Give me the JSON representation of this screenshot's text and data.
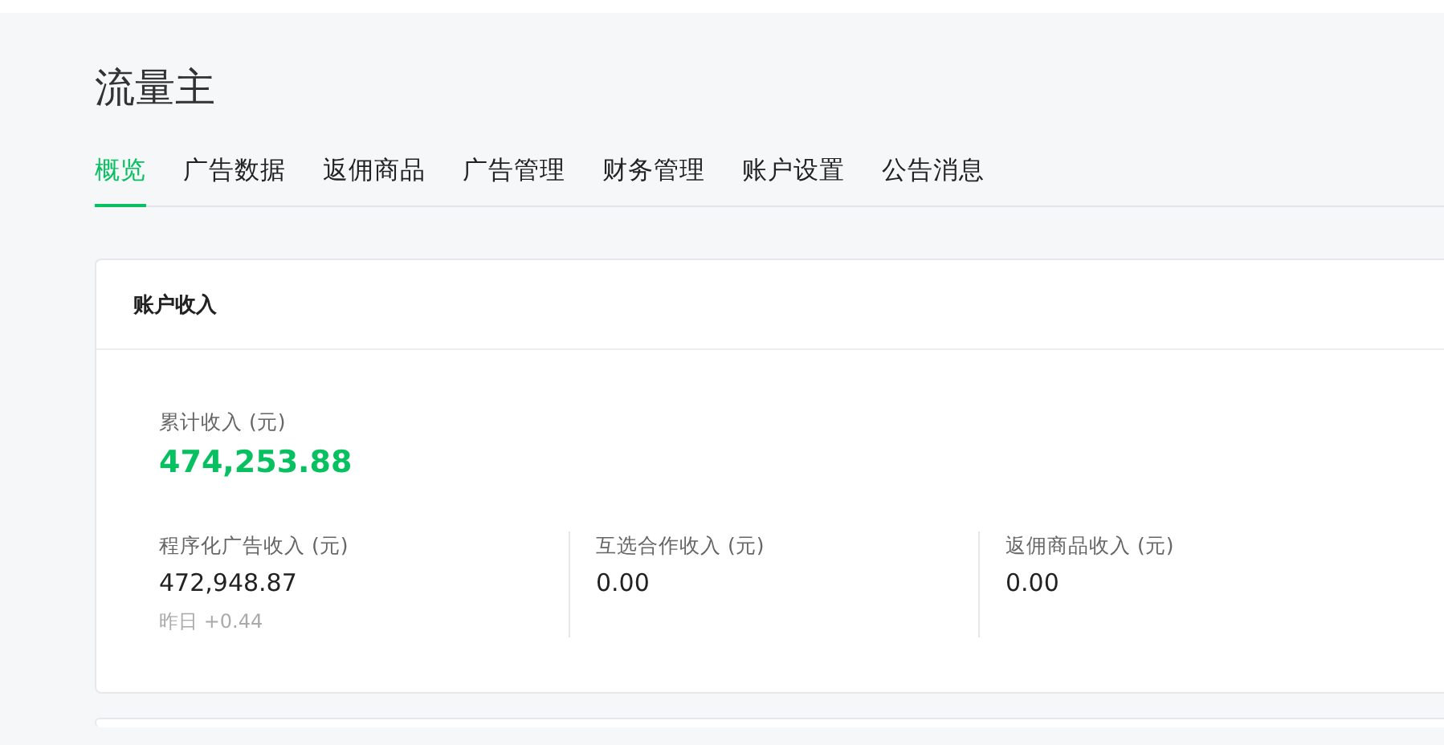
{
  "app": {
    "title": "流量主"
  },
  "tabs": [
    {
      "label": "概览",
      "selected": true
    },
    {
      "label": "广告数据",
      "selected": false
    },
    {
      "label": "返佣商品",
      "selected": false
    },
    {
      "label": "广告管理",
      "selected": false
    },
    {
      "label": "财务管理",
      "selected": false
    },
    {
      "label": "账户设置",
      "selected": false
    },
    {
      "label": "公告消息",
      "selected": false
    }
  ],
  "income_card": {
    "title": "账户收入",
    "total": {
      "label": "累计收入 (元)",
      "value": "474,253.88"
    },
    "items": [
      {
        "label": "程序化广告收入 (元)",
        "value": "472,948.87",
        "note": "昨日 +0.44"
      },
      {
        "label": "互选合作收入 (元)",
        "value": "0.00"
      },
      {
        "label": "返佣商品收入 (元)",
        "value": "0.00"
      }
    ]
  }
}
